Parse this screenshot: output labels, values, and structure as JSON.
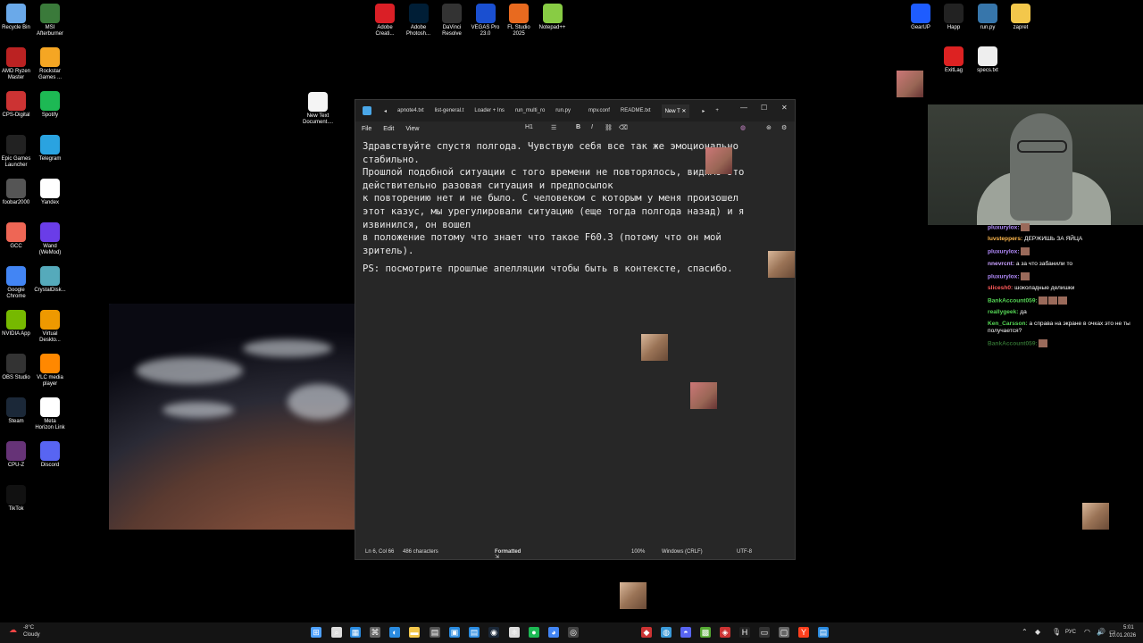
{
  "desktop_icons_left": [
    {
      "label": "Recycle Bin",
      "icon": "recycle-bin-icon",
      "color": "#6aa9e9"
    },
    {
      "label": "MSI\nAfterburner",
      "icon": "msi-afterburner-icon",
      "color": "#3a7a3a"
    },
    {
      "label": "AMD Ryzen\nMaster",
      "icon": "amd-ryzen-icon",
      "color": "#b22"
    },
    {
      "label": "Rockstar\nGames ...",
      "icon": "rockstar-icon",
      "color": "#f5a623"
    },
    {
      "label": "CPS-Digital",
      "icon": "cps-digital-icon",
      "color": "#c33"
    },
    {
      "label": "Spotify",
      "icon": "spotify-icon",
      "color": "#1db954"
    },
    {
      "label": "Epic Games\nLauncher",
      "icon": "epic-games-icon",
      "color": "#222"
    },
    {
      "label": "Telegram",
      "icon": "telegram-icon",
      "color": "#2aa3e0"
    },
    {
      "label": "foobar2000",
      "icon": "foobar-icon",
      "color": "#555"
    },
    {
      "label": "Yandex",
      "icon": "yandex-icon",
      "color": "#fff"
    },
    {
      "label": "GCC",
      "icon": "gcc-icon",
      "color": "#e65"
    },
    {
      "label": "Wand\n(WeMod)",
      "icon": "wand-icon",
      "color": "#6a3de8"
    },
    {
      "label": "Google\nChrome",
      "icon": "chrome-icon",
      "color": "#4285f4"
    },
    {
      "label": "CrystalDisk...",
      "icon": "crystaldisk-icon",
      "color": "#5ab"
    },
    {
      "label": "NVIDIA App",
      "icon": "nvidia-icon",
      "color": "#76b900"
    },
    {
      "label": "Virtual\nDeskto...",
      "icon": "virtual-desktop-icon",
      "color": "#e90"
    },
    {
      "label": "OBS Studio",
      "icon": "obs-icon",
      "color": "#333"
    },
    {
      "label": "VLC media\nplayer",
      "icon": "vlc-icon",
      "color": "#f80"
    },
    {
      "label": "Steam",
      "icon": "steam-icon",
      "color": "#1b2838"
    },
    {
      "label": "Meta\nHorizon Link",
      "icon": "meta-icon",
      "color": "#fff"
    },
    {
      "label": "CPU-Z",
      "icon": "cpuz-icon",
      "color": "#637"
    },
    {
      "label": "Discord",
      "icon": "discord-icon",
      "color": "#5865f2"
    },
    {
      "label": "TikTok",
      "icon": "tiktok-icon",
      "color": "#111"
    }
  ],
  "desktop_icons_top": [
    {
      "label": "Adobe\nCreati...",
      "icon": "adobe-cc-icon",
      "color": "#da1f26"
    },
    {
      "label": "Adobe\nPhotosh...",
      "icon": "photoshop-icon",
      "color": "#001e36"
    },
    {
      "label": "DaVinci\nResolve",
      "icon": "davinci-icon",
      "color": "#333"
    },
    {
      "label": "VEGAS Pro\n23.0",
      "icon": "vegas-icon",
      "color": "#1a4fd0"
    },
    {
      "label": "FL Studio\n2025",
      "icon": "fl-studio-icon",
      "color": "#e86a1f"
    },
    {
      "label": "Notepad++",
      "icon": "notepadpp-icon",
      "color": "#8c4"
    }
  ],
  "desktop_icons_right": [
    {
      "label": "GearUP",
      "icon": "gearup-icon",
      "color": "#1e5cff"
    },
    {
      "label": "Happ",
      "icon": "happ-icon",
      "color": "#222"
    },
    {
      "label": "run.py",
      "icon": "python-file-icon",
      "color": "#3776ab"
    },
    {
      "label": "zapret",
      "icon": "folder-icon",
      "color": "#f3c74b"
    },
    {
      "label": "ExitLag",
      "icon": "exitlag-icon",
      "color": "#d22"
    },
    {
      "label": "specs.txt",
      "icon": "text-file-icon",
      "color": "#eee"
    }
  ],
  "new_text_doc": {
    "label": "New Text\nDocument....",
    "icon": "text-file-icon"
  },
  "notepad": {
    "tabs": [
      "apnote4.txt",
      "list-general.t",
      "Loader + Ins",
      "run_multi_ro",
      "run.py",
      "mpv.conf",
      "README.txt",
      "New T"
    ],
    "menu": [
      "File",
      "Edit",
      "View"
    ],
    "toolbar": {
      "heading": "H1",
      "list": "☰",
      "bold": "B",
      "italic": "I",
      "link": "⛓",
      "clear": "⌫"
    },
    "lines": [
      "Здравствуйте спустя полгода. Чувствую себя все так же эмоционально",
      "стабильно.",
      "Прошлой подобной ситуации с того времени не повторялось, видимо это",
      "действительно разовая ситуация и предпосылок",
      "к повторению нет и не было. С человеком с которым у меня произошел",
      "этот казус, мы урегулировали ситуацию (еще тогда полгода назад) и я",
      "извинился, он вошел",
      "в положение потому что знает что такое F60.3 (потому что он мой",
      "зритель).",
      "PS: посмотрите прошлые апелляции чтобы быть в контексте, спасибо."
    ],
    "status": {
      "position": "Ln 6, Col 66",
      "chars": "486 characters",
      "format": "Formatted",
      "zoom": "100%",
      "eol": "Windows (CRLF)",
      "encoding": "UTF-8"
    }
  },
  "chat": [
    {
      "user": "pluxurylox:",
      "color": "#b48cff",
      "msg": "",
      "emotes": 1
    },
    {
      "user": "luvsteppers:",
      "color": "#ffb84d",
      "msg": "ДЕРЖИШЬ ЗА ЯЙЦА",
      "emotes": 0
    },
    {
      "user": "pluxurylox:",
      "color": "#b48cff",
      "msg": "",
      "emotes": 1
    },
    {
      "user": "nnevrcnt:",
      "color": "#c9a0ff",
      "msg": "а за что забанили то",
      "emotes": 0
    },
    {
      "user": "pluxurylox:",
      "color": "#b48cff",
      "msg": "",
      "emotes": 1
    },
    {
      "user": "slicesh0:",
      "color": "#ff5a5a",
      "msg": "шоколадные делишки",
      "emotes": 0
    },
    {
      "user": "BankAccount059:",
      "color": "#55d655",
      "msg": "",
      "emotes": 3
    },
    {
      "user": "reallygeek:",
      "color": "#55d655",
      "msg": "да",
      "emotes": 0
    },
    {
      "user": "Ken_Carsson:",
      "color": "#55d655",
      "msg": "а справа на экране в очках это не ты получается?",
      "emotes": 0
    },
    {
      "user": "BankAccount059:",
      "color": "#2f6a2f",
      "msg": "",
      "emotes": 1
    }
  ],
  "weather": {
    "temp": "-8°C",
    "desc": "Cloudy"
  },
  "tray": {
    "lang": "РУС",
    "time": "5:01",
    "date": "10.01.2026"
  }
}
